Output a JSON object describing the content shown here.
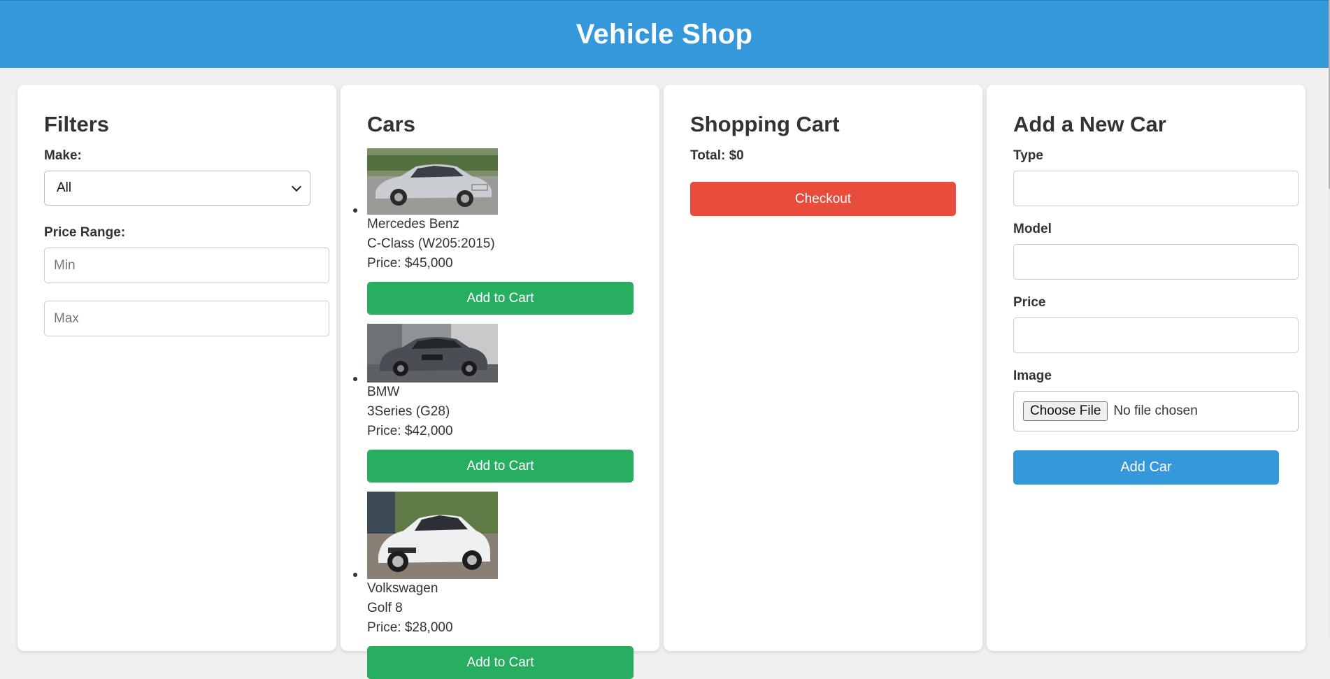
{
  "header": {
    "title": "Vehicle Shop"
  },
  "filters": {
    "heading": "Filters",
    "make_label": "Make:",
    "make_selected": "All",
    "price_label": "Price Range:",
    "min_placeholder": "Min",
    "max_placeholder": "Max"
  },
  "cars": {
    "heading": "Cars",
    "items": [
      {
        "make": "Mercedes Benz",
        "model": "C-Class (W205:2015)",
        "price": "Price: $45,000",
        "button": "Add to Cart",
        "image_desc": "silver sedan"
      },
      {
        "make": "BMW",
        "model": "3Series (G28)",
        "price": "Price: $42,000",
        "button": "Add to Cart",
        "image_desc": "grey sedan"
      },
      {
        "make": "Volkswagen",
        "model": "Golf 8",
        "price": "Price: $28,000",
        "button": "Add to Cart",
        "image_desc": "white hatchback"
      }
    ]
  },
  "cart": {
    "heading": "Shopping Cart",
    "total": "Total: $0",
    "checkout": "Checkout"
  },
  "add_car": {
    "heading": "Add a New Car",
    "type_label": "Type",
    "model_label": "Model",
    "price_label": "Price",
    "image_label": "Image",
    "choose_file": "Choose File",
    "no_file": "No file chosen",
    "submit": "Add Car"
  },
  "colors": {
    "header": "#3498db",
    "add_to_cart": "#27ae60",
    "checkout": "#e74c3c",
    "add_car": "#3498db"
  }
}
